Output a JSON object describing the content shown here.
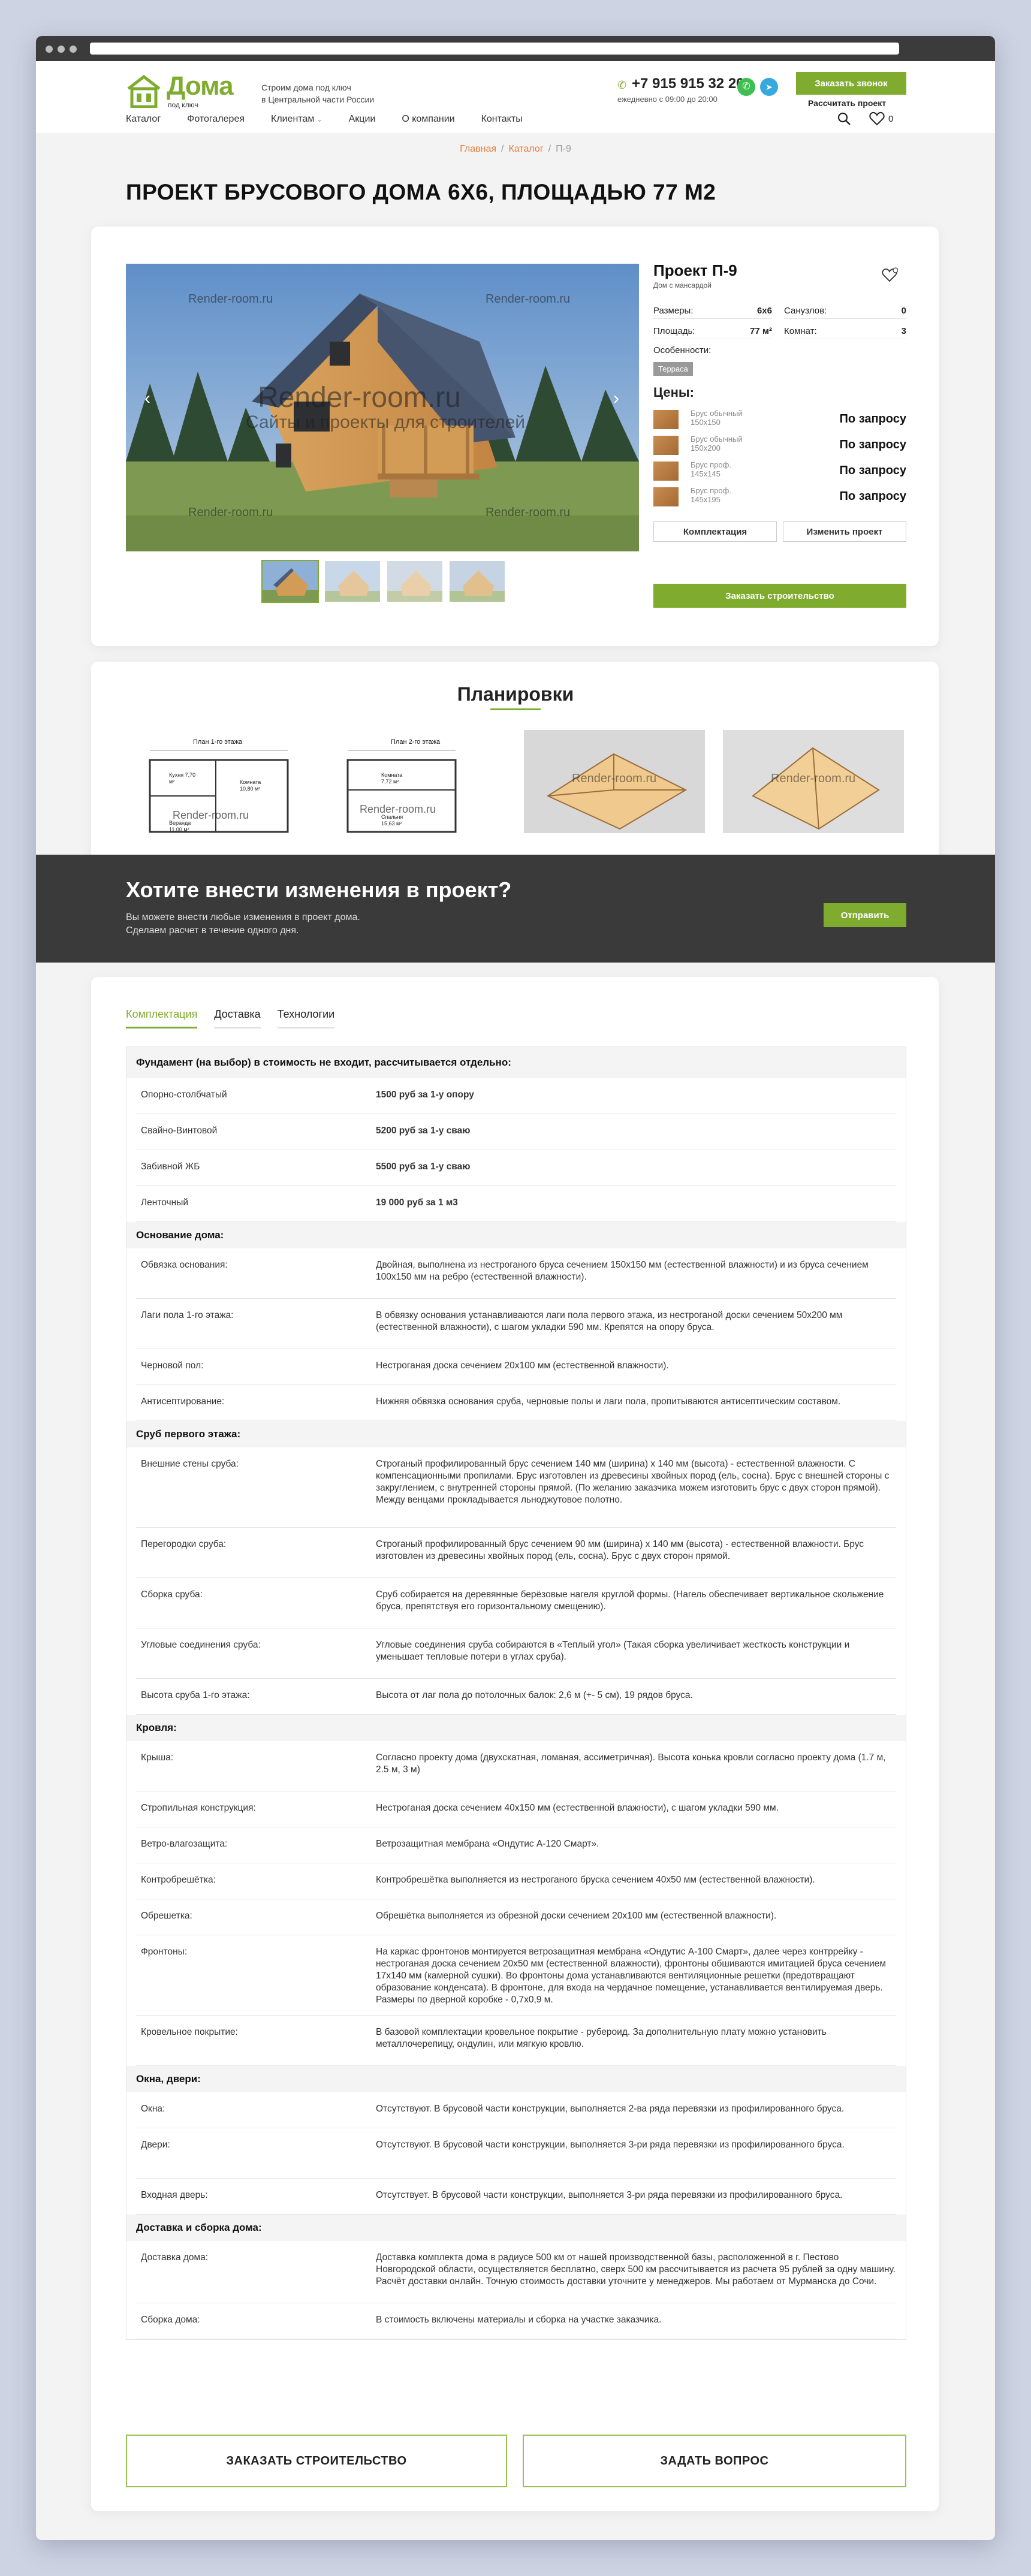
{
  "header": {
    "logo_text": "Дома",
    "logo_sub": "под ключ",
    "tagline_1": "Строим дома под ключ",
    "tagline_2": "в Центральной части России",
    "phone": "+7 915 915 32 20",
    "hours": "ежедневно с 09:00 до 20:00",
    "call_button": "Заказать звонок",
    "calc_link": "Рассчитать проект",
    "fav_count": "0",
    "nav": [
      "Каталог",
      "Фотогалерея",
      "Клиентам",
      "Акции",
      "О компании",
      "Контакты"
    ]
  },
  "breadcrumb": {
    "home": "Главная",
    "catalog": "Каталог",
    "current": "П-9"
  },
  "page_title": "ПРОЕКТ БРУСОВОГО ДОМА 6Х6, ПЛОЩАДЬЮ 77 М2",
  "gallery": {
    "watermark_big": "Render-room.ru",
    "watermark_sub": "Сайты и проекты для строителей",
    "watermark_small": "Render-room.ru"
  },
  "product": {
    "title": "Проект П-9",
    "subtitle": "Дом с мансардой",
    "specs": {
      "size_label": "Размеры:",
      "size_value": "6x6",
      "bath_label": "Санузлов:",
      "bath_value": "0",
      "area_label": "Площадь:",
      "area_value": "77 м²",
      "rooms_label": "Комнат:",
      "rooms_value": "3",
      "features_label": "Особенности:",
      "feature_tag": "Терраса"
    },
    "prices_title": "Цены:",
    "prices": [
      {
        "name": "Брус обычный 150x150",
        "value": "По запросу"
      },
      {
        "name": "Брус обычный 150x200",
        "value": "По запросу"
      },
      {
        "name": "Брус проф. 145x145",
        "value": "По запросу"
      },
      {
        "name": "Брус проф. 145x195",
        "value": "По запросу"
      }
    ],
    "kit_button": "Комплектация",
    "change_button": "Изменить проект",
    "order_button": "Заказать строительство"
  },
  "plans": {
    "title": "Планировки",
    "plan1_title": "План 1-го этажа",
    "plan2_title": "План 2-го этажа",
    "plan_labels": [
      "Кухня 7,70 м²",
      "Комната 10,80 м²",
      "Веранда 11,00 м²",
      "Комната 7,72 м²",
      "Спальня 15,63 м²"
    ],
    "watermark": "Render-room.ru"
  },
  "banner": {
    "title": "Хотите внести изменения в проект?",
    "line1": "Вы можете внести любые изменения в проект дома.",
    "line2": "Сделаем расчет в течение одного дня.",
    "button": "Отправить"
  },
  "tabs": [
    "Комплектация",
    "Доставка",
    "Технологии"
  ],
  "spec_table": [
    {
      "section": "Фундамент (на выбор) в стоимость не входит, рассчитывается отдельно:",
      "rows": [
        {
          "k": "Опорно-столбчатый",
          "v": "1500 руб за 1-у опору",
          "bold": true
        },
        {
          "k": "Свайно-Винтовой",
          "v": "5200 руб за 1-у сваю",
          "bold": true
        },
        {
          "k": "Забивной ЖБ",
          "v": "5500 руб за 1-у сваю",
          "bold": true
        },
        {
          "k": "Ленточный",
          "v": "19 000 руб за 1 м3",
          "bold": true
        }
      ]
    },
    {
      "section": "Основание дома:",
      "rows": [
        {
          "k": "Обвязка основания:",
          "v": "Двойная, выполнена из нестроганого бруса сечением 150х150 мм (естественной влажности) и из бруса сечением 100х150 мм на ребро (естественной влажности)."
        },
        {
          "k": "Лаги пола 1-го этажа:",
          "v": "В обвязку основания устанавливаются лаги пола первого этажа, из нестроганой доски сечением 50х200 мм (естественной влажности), с шагом укладки 590 мм. Крепятся на опору бруса."
        },
        {
          "k": "Черновой пол:",
          "v": "Нестроганая доска сечением 20х100 мм (естественной влажности)."
        },
        {
          "k": "Антисептирование:",
          "v": "Нижняя обвязка основания сруба, черновые полы и лаги пола, пропитываются антисептическим составом."
        }
      ]
    },
    {
      "section": "Сруб первого этажа:",
      "rows": [
        {
          "k": "Внешние стены сруба:",
          "v": "Строганый профилированный брус сечением 140 мм (ширина) х 140 мм (высота) - естественной влажности. С компенсационными пропилами. Брус изготовлен из древесины хвойных пород (ель, сосна). Брус с внешней стороны с закруглением, с внутренней стороны прямой. (По желанию заказчика можем изготовить брус с двух сторон прямой). Между венцами прокладывается льноджутовое полотно."
        },
        {
          "k": "Перегородки сруба:",
          "v": "Строганый профилированный брус сечением 90 мм (ширина) х 140 мм (высота) - естественной влажности. Брус изготовлен из древесины хвойных пород (ель, сосна). Брус с двух сторон прямой."
        },
        {
          "k": "Сборка сруба:",
          "v": "Сруб собирается на деревянные берёзовые нагеля круглой формы. (Нагель обеспечивает вертикальное скольжение бруса, препятствуя его горизонтальному смещению)."
        },
        {
          "k": "Угловые соединения сруба:",
          "v": "Угловые соединения сруба собираются в «Теплый угол» (Такая сборка увеличивает жесткость конструкции и уменьшает тепловые потери в углах сруба)."
        },
        {
          "k": "Высота сруба 1-го этажа:",
          "v": "Высота от лаг пола до потолочных балок: 2,6 м (+- 5 см), 19 рядов бруса."
        }
      ]
    },
    {
      "section": "Кровля:",
      "rows": [
        {
          "k": "Крыша:",
          "v": "Согласно проекту дома (двухскатная, ломаная, ассиметричная). Высота конька кровли согласно проекту дома (1.7 м, 2.5 м, 3 м)"
        },
        {
          "k": "Стропильная конструкция:",
          "v": "Нестроганая доска сечением 40х150 мм (естественной влажности), с шагом укладки 590 мм."
        },
        {
          "k": "Ветро-влагозащита:",
          "v": "Ветрозащитная мембрана «Ондутис А-120 Смарт»."
        },
        {
          "k": "Контробрешётка:",
          "v": "Контробрешётка выполняется из нестроганого бруска сечением 40х50 мм (естественной влажности)."
        },
        {
          "k": "Обрешетка:",
          "v": "Обрешётка выполняется из обрезной доски сечением 20х100 мм (естественной влажности)."
        },
        {
          "k": "Фронтоны:",
          "v": "На каркас фронтонов монтируется ветрозащитная мембрана «Ондутис А-100 Смарт», далее через контррейку - нестроганая доска сечением 20х50 мм (естественной влажности), фронтоны обшиваются имитацией бруса сечением 17х140 мм (камерной сушки). Во фронтоны дома устанавливаются вентиляционные решетки (предотвращают образование конденсата). В фронтоне, для входа на чердачное помещение, устанавливается вентилируемая дверь. Размеры по дверной коробке - 0,7х0,9 м."
        },
        {
          "k": "Кровельное покрытие:",
          "v": "В базовой комплектации кровельное покрытие - рубероид. За дополнительную плату можно установить металлочерепицу, ондулин, или мягкую кровлю."
        }
      ]
    },
    {
      "section": "Окна, двери:",
      "rows": [
        {
          "k": "Окна:",
          "v": "Отсутствуют. В брусовой части конструкции, выполняется 2-ва ряда перевязки из профилированного бруса."
        },
        {
          "k": "Двери:",
          "v": "Отсутствуют. В брусовой части конструкции, выполняется 3-ри ряда перевязки из профилированного бруса."
        },
        {
          "k": "Входная дверь:",
          "v": "Отсутствует. В брусовой части конструкции, выполняется 3-ри ряда перевязки из профилированного бруса."
        }
      ]
    },
    {
      "section": "Доставка и сборка дома:",
      "rows": [
        {
          "k": "Доставка дома:",
          "v": "Доставка комплекта дома в радиусе 500 км от нашей производственной базы, расположенной в г. Пестово Новгородской области, осуществляется бесплатно, сверх 500 км рассчитывается из расчета 95 рублей за одну машину. Расчёт доставки онлайн. Точную стоимость доставки уточните у менеджеров. Мы работаем от Мурманска до Сочи."
        },
        {
          "k": "Сборка дома:",
          "v": "В стоимость включены материалы и сборка на участке заказчика."
        }
      ]
    }
  ],
  "bottom_buttons": {
    "order": "ЗАКАЗАТЬ СТРОИТЕЛЬСТВО",
    "ask": "ЗАДАТЬ ВОПРОС"
  },
  "colors": {
    "accent": "#7fac2e",
    "breadcrumb": "#e67b3a",
    "banner_bg": "#3a3a3a"
  }
}
